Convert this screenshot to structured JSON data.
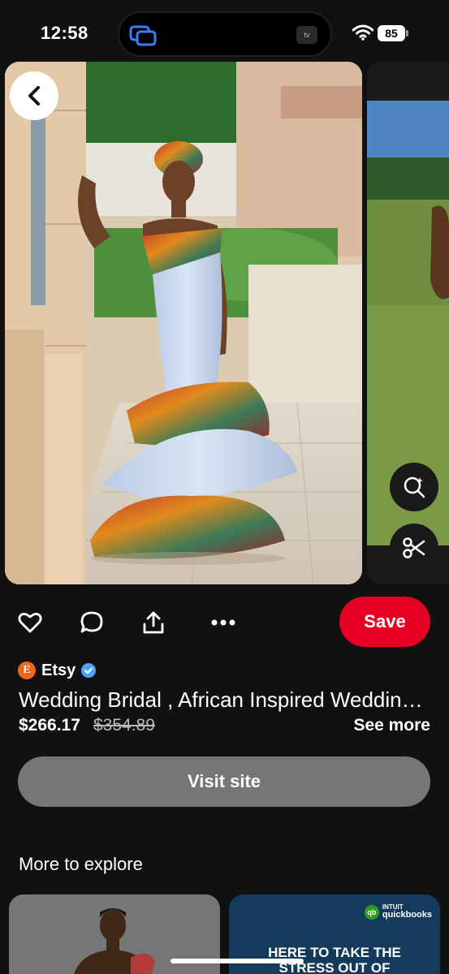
{
  "status_bar": {
    "time": "12:58",
    "battery": "85",
    "island_right_label": "tv"
  },
  "pin": {
    "image_alt": "Woman in white mermaid wedding dress with African print ruffles and head wrap",
    "next_image_alt": "Person standing on green field"
  },
  "icons": {
    "back": "chevron-left-icon",
    "visual_search": "visual-search-icon",
    "scissors": "scissors-icon",
    "like": "heart-icon",
    "comment": "comment-icon",
    "share": "share-icon",
    "more": "more-icon"
  },
  "actions": {
    "save_label": "Save"
  },
  "merchant": {
    "logo_letter": "E",
    "name": "Etsy",
    "verified": true
  },
  "product": {
    "title": "Wedding Bridal , African Inspired Wedding Dress",
    "price": "$266.17",
    "original_price": "$354.89",
    "see_more_label": "See more",
    "visit_label": "Visit site"
  },
  "explore": {
    "heading": "More to explore",
    "ad": {
      "brand_parent": "INTUIT",
      "brand": "quickbooks",
      "logo_text": "qb",
      "headline_line1": "HERE TO TAKE THE",
      "headline_line2": "STRESS OUT OF"
    }
  },
  "colors": {
    "background": "#111111",
    "save_red": "#e60023",
    "visit_gray": "#767676",
    "etsy_orange": "#f1641e",
    "verified_blue": "#4da3ff"
  }
}
